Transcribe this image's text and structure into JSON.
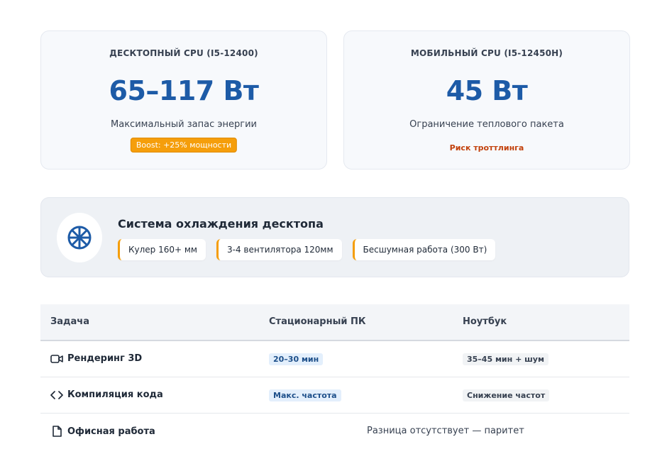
{
  "cards": {
    "desktop": {
      "title": "ДЕСКТОПНЫЙ CPU (I5-12400)",
      "value": "65–117 Вт",
      "subtitle": "Максимальный запас энергии",
      "badge": "Boost: +25% мощности"
    },
    "mobile": {
      "title": "МОБИЛЬНЫЙ CPU (I5-12450H)",
      "value": "45 Вт",
      "subtitle": "Ограничение теплового пакета",
      "note": "Риск троттлинга"
    }
  },
  "cooling": {
    "icon": "fan-icon",
    "title": "Система охлаждения десктопа",
    "tags": [
      "Кулер 160+ мм",
      "3-4 вентилятора 120мм",
      "Бесшумная работа (300 Вт)"
    ]
  },
  "table": {
    "headers": [
      "Задача",
      "Стационарный ПК",
      "Ноутбук"
    ],
    "rows": [
      {
        "icon": "video-camera-icon",
        "task": "Рендеринг 3D",
        "pc": "20–30 мин",
        "laptop": "35–45 мин + шум"
      },
      {
        "icon": "code-icon",
        "task": "Компиляция кода",
        "pc": "Макс. частота",
        "laptop": "Снижение частот"
      },
      {
        "icon": "document-icon",
        "task": "Офисная работа",
        "merged": "Разница отсутствует — паритет"
      }
    ]
  },
  "colors": {
    "accent_blue": "#1d5ba7",
    "accent_orange": "#f59e0b",
    "risk_red": "#c2410c"
  }
}
